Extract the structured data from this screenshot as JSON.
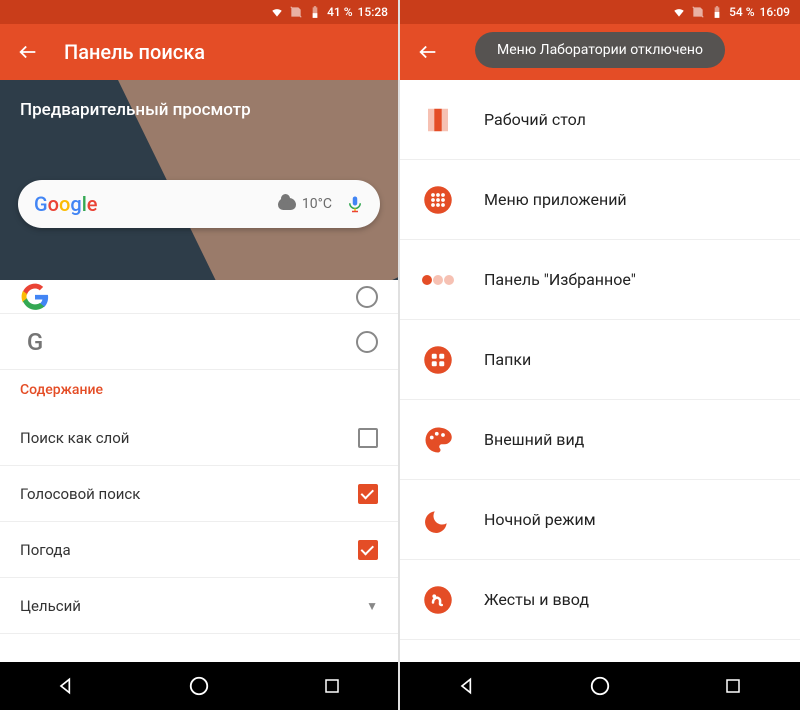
{
  "left": {
    "status": {
      "battery": "41 %",
      "time": "15:28"
    },
    "appbar_title": "Панель поиска",
    "preview_label": "Предварительный просмотр",
    "search_pill": {
      "logo": [
        "G",
        "o",
        "o",
        "g",
        "l",
        "e"
      ],
      "weather_temp": "10°C"
    },
    "rows": {
      "logo_mono": "G",
      "section_header": "Содержание",
      "opt_layer": "Поиск как слой",
      "opt_voice": "Голосовой поиск",
      "opt_weather": "Погода",
      "opt_celsius": "Цельсий"
    }
  },
  "right": {
    "status": {
      "battery": "54 %",
      "time": "16:09"
    },
    "toast": "Меню Лаборатории отключено",
    "items": [
      {
        "key": "desktop",
        "label": "Рабочий стол"
      },
      {
        "key": "appmenu",
        "label": "Меню приложений"
      },
      {
        "key": "favorites",
        "label": "Панель \"Избранное\""
      },
      {
        "key": "folders",
        "label": "Папки"
      },
      {
        "key": "look",
        "label": "Внешний вид"
      },
      {
        "key": "night",
        "label": "Ночной режим"
      },
      {
        "key": "gestures",
        "label": "Жесты и ввод"
      }
    ]
  },
  "colors": {
    "accent": "#e44d26"
  }
}
